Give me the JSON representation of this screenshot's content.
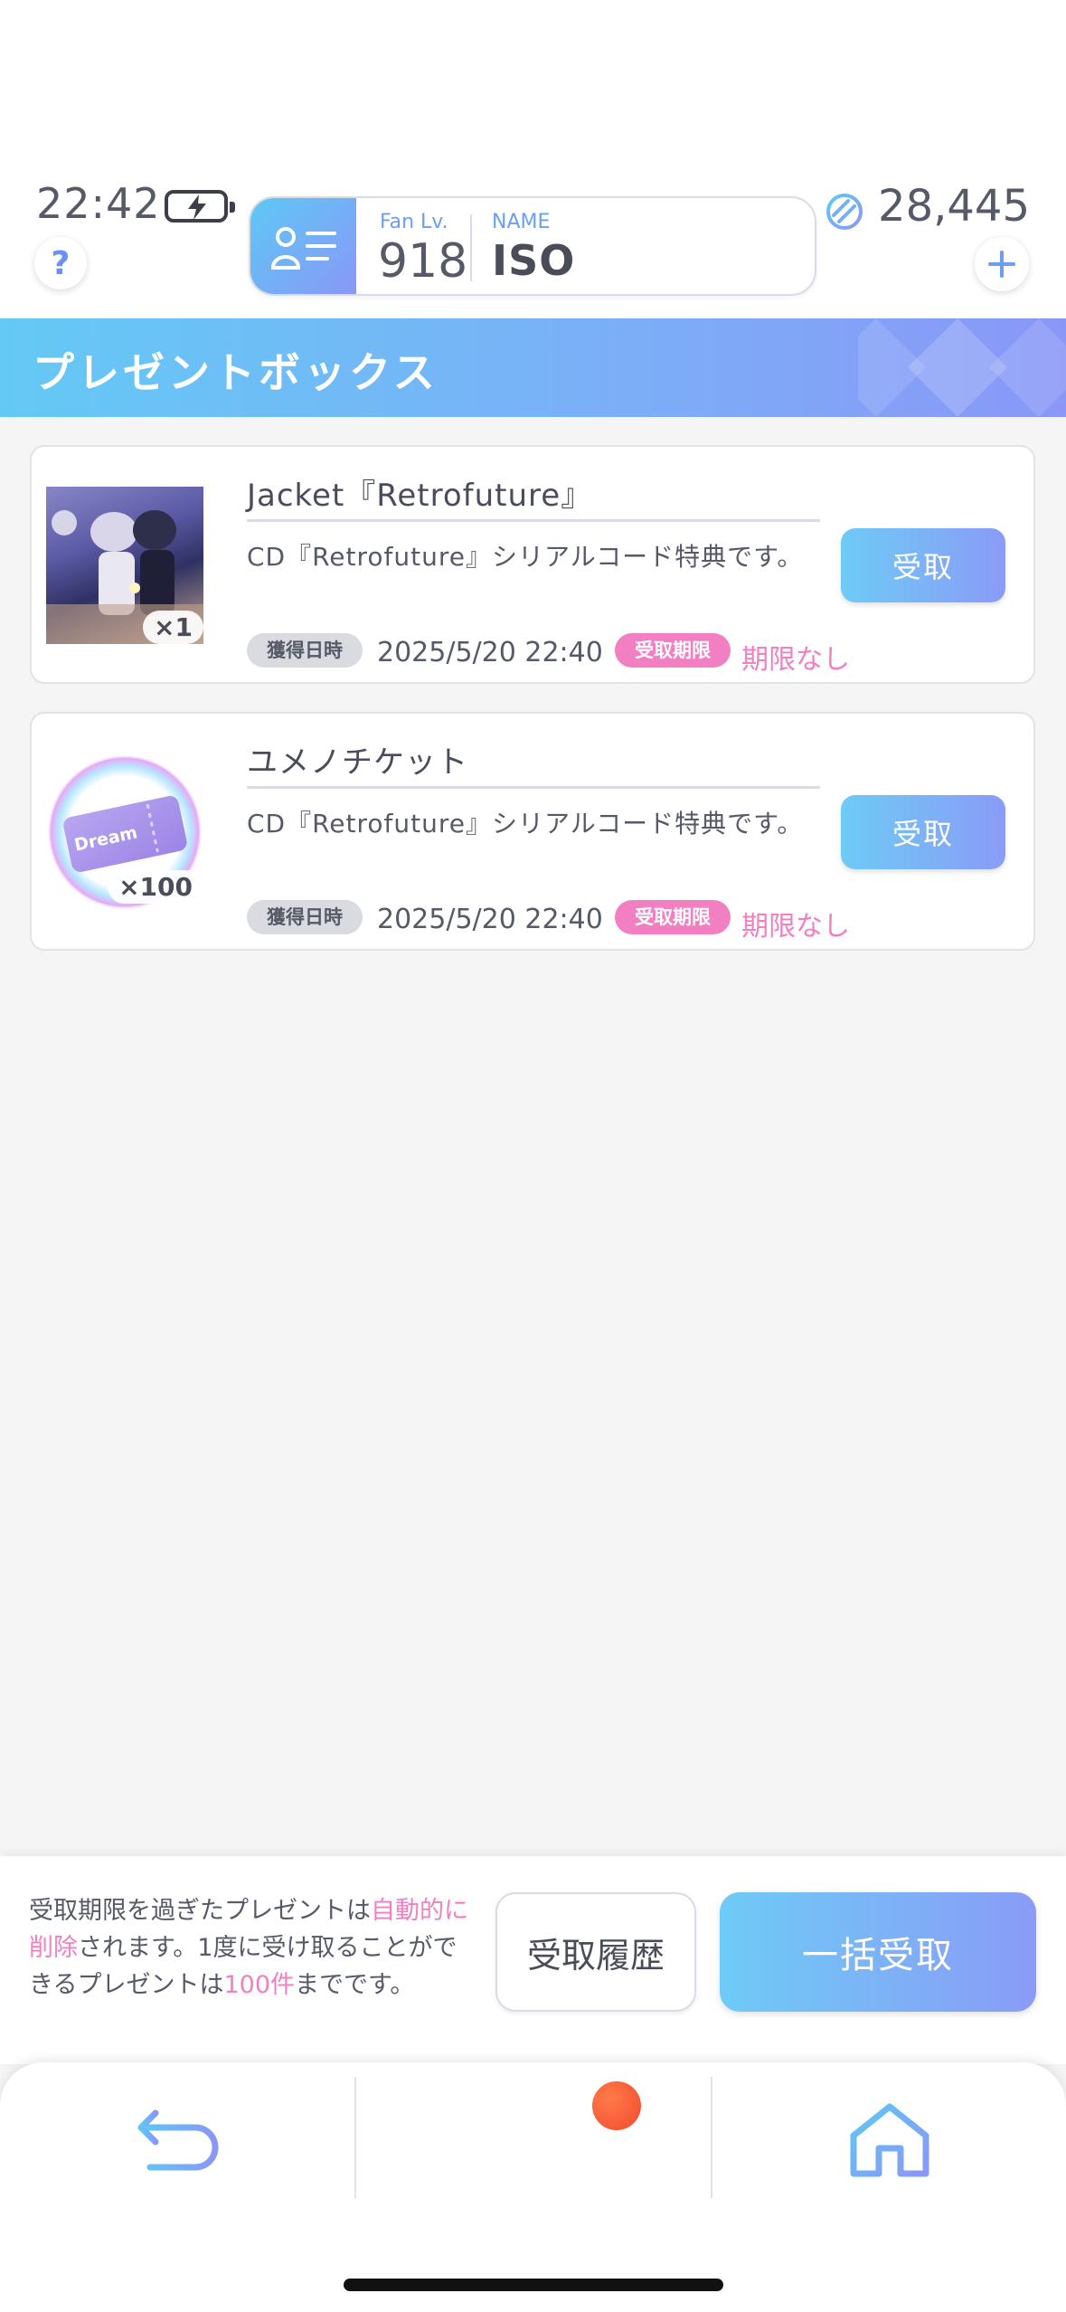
{
  "status": {
    "time": "22:42"
  },
  "profile": {
    "fan_label": "Fan Lv.",
    "fan_level": "918",
    "name_label": "NAME",
    "name": "ISO"
  },
  "currency": {
    "amount": "28,445"
  },
  "page": {
    "title": "プレゼントボックス"
  },
  "gifts": [
    {
      "title": "Jacket『Retrofuture』",
      "description": "CD『Retrofuture』シリアルコード特典です。",
      "quantity": "×1",
      "acquired_label": "獲得日時",
      "acquired_date": "2025/5/20 22:40",
      "limit_label": "受取期限",
      "limit_value": "期限なし",
      "claim_label": "受取"
    },
    {
      "title": "ユメノチケット",
      "description": "CD『Retrofuture』シリアルコード特典です。",
      "quantity": "×100",
      "ticket_text": "Dream",
      "acquired_label": "獲得日時",
      "acquired_date": "2025/5/20 22:40",
      "limit_label": "受取期限",
      "limit_value": "期限なし",
      "claim_label": "受取"
    }
  ],
  "footer": {
    "note_part1": "受取期限を過ぎたプレゼントは",
    "note_highlight1": "自動的に削除",
    "note_part2": "されます。1度に受け取ることができるプレゼントは",
    "note_highlight2": "100件",
    "note_part3": "までです。",
    "history_label": "受取履歴",
    "bulk_label": "一括受取"
  },
  "nav": {
    "items": [
      "back-icon",
      "menu-icon",
      "home-icon"
    ],
    "has_notification": true
  },
  "colors": {
    "accent_start": "#64c9f5",
    "accent_end": "#8a97f7",
    "pink": "#f27fc2",
    "notification": "#f2492e"
  }
}
